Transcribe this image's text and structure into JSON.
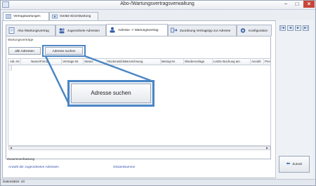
{
  "window": {
    "title": "Abo-/Wartungsvertragsverwaltung",
    "controls": [
      "−",
      "□",
      "×"
    ]
  },
  "outer_tabs": [
    {
      "label": "Vertragswartungen",
      "active": true
    },
    {
      "label": "Geräte Einzelwartung",
      "active": false
    }
  ],
  "inner_tabs": [
    {
      "label": "Abo-/Wartungsvertrag",
      "active": false
    },
    {
      "label": "zugeordnete Adressen",
      "active": false
    },
    {
      "label": "Adresse -> Wartungsvertrag",
      "active": true
    },
    {
      "label": "Zuordnung Vertragstyp zur Adresse",
      "active": false
    },
    {
      "label": "Konfiguration",
      "active": false
    }
  ],
  "group": {
    "label": "Wartungsverträge"
  },
  "buttons": {
    "all_addresses": "alle Adressen",
    "search_address": "Adresse suchen",
    "back": "Zurück"
  },
  "grid": {
    "columns": [
      "Adr.-Nr.",
      "Name/Firma",
      "Vertrags-Nr.",
      "Status",
      "Rückmeldchen",
      "Bezeichnung",
      "Betrag-Nr.",
      "Wiedervorlage",
      "Letzte Buchung am",
      "Anzahl",
      "Prei"
    ]
  },
  "nav_buttons": [
    "|◄",
    "◄",
    "►",
    "►|"
  ],
  "summary": {
    "label": "Zusammenfassung",
    "count_label": "Anzahl der zugeordneten Adressen",
    "total_label": "Gesamtsumme"
  },
  "status": {
    "text": "Datensätze: 10"
  },
  "callout": {
    "label": "Adresse suchen"
  },
  "colors": {
    "accent": "#4b86c4",
    "link": "#2f4fa8",
    "close": "#c9453a"
  }
}
